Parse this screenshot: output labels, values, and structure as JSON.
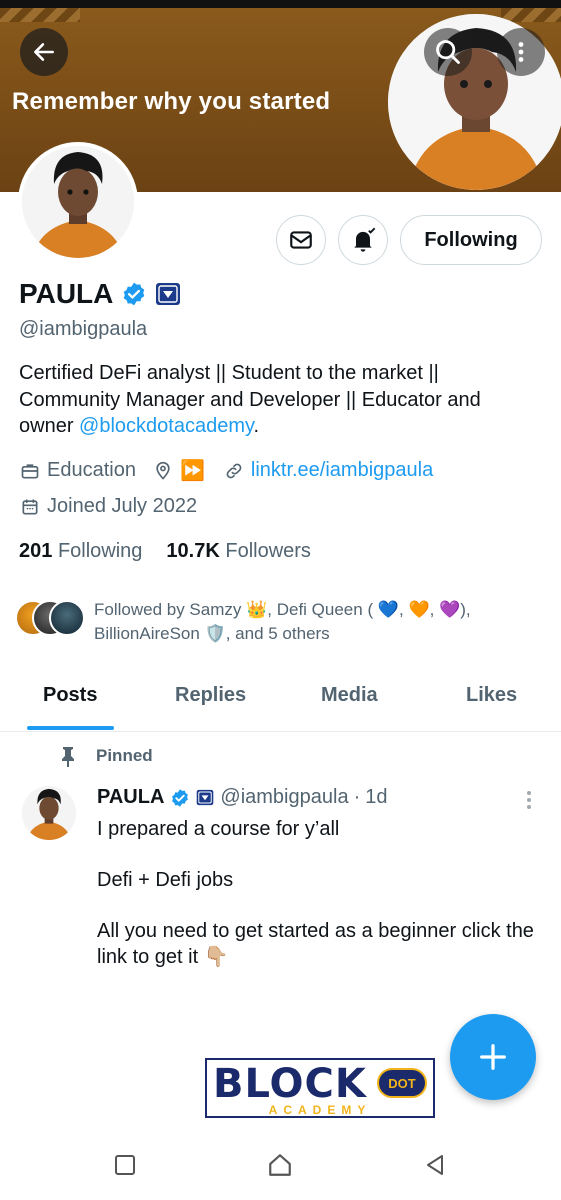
{
  "banner": {
    "text": "Remember why you started"
  },
  "profile": {
    "name": "PAULA",
    "handle": "@iambigpaula",
    "bio_text": "Certified DeFi analyst || Student to the market || Community Manager and Developer || Educator and owner ",
    "bio_mention": "@blockdotacademy",
    "bio_end": ".",
    "category": "Education",
    "location_emoji": "⏩",
    "website": "linktr.ee/iambigpaula",
    "joined": "Joined July 2022",
    "following_count": "201",
    "following_label": "Following",
    "followers_count": "10.7K",
    "followers_label": "Followers",
    "followed_by": "Followed by Samzy 👑, Defi Queen ( 💙, 🧡, 💜), BillionAireSon 🛡️, and 5 others",
    "following_button": "Following"
  },
  "tabs": [
    "Posts",
    "Replies",
    "Media",
    "Likes"
  ],
  "tweet": {
    "pinned_label": "Pinned",
    "name": "PAULA",
    "handle": "@iambigpaula",
    "separator": "·",
    "time": "1d",
    "line1": "I prepared a course for y’all",
    "line2": "Defi + Defi jobs",
    "line3": "All you need to get started as a beginner click the link to get it 👇🏼"
  },
  "logo": {
    "main": "BLOCK",
    "dot": "DOT",
    "sub": "ACADEMY"
  },
  "colors": {
    "accent": "#1d9bf0",
    "banner": "#7a4d17",
    "text_secondary": "#536471"
  },
  "icons": {
    "back": "arrow-left-icon",
    "search": "search-icon",
    "more": "more-vertical-icon",
    "message": "mail-icon",
    "notify": "bell-check-icon",
    "verified": "verified-badge-icon",
    "category": "briefcase-icon",
    "location": "location-pin-icon",
    "link": "link-icon",
    "calendar": "calendar-icon",
    "pin": "pin-icon",
    "compose": "plus-icon"
  }
}
